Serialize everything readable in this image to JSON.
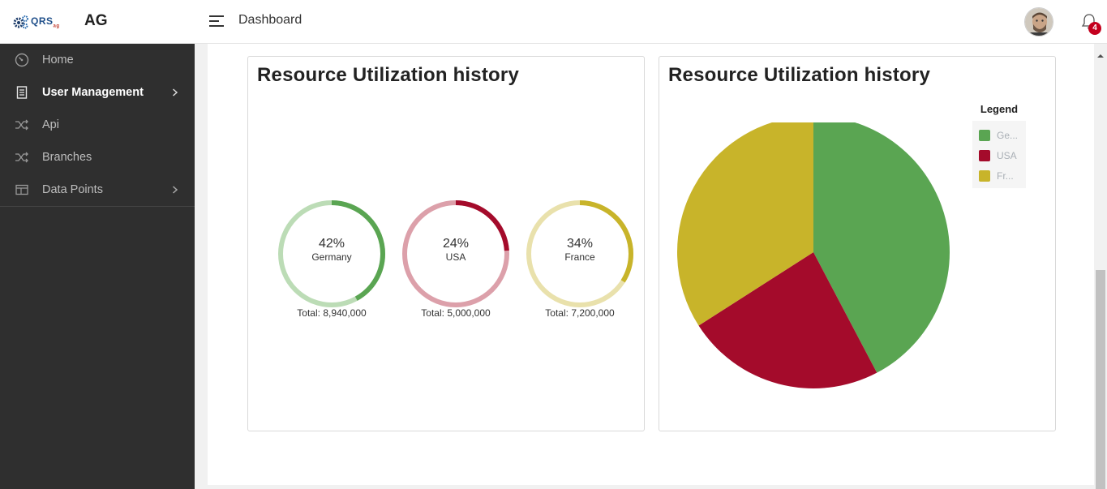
{
  "header": {
    "brand": "AG",
    "logo_text": "QRS",
    "logo_suffix": "ag",
    "page_title": "Dashboard",
    "notification_count": "4"
  },
  "sidebar": {
    "items": [
      {
        "label": "Home",
        "icon": "dashboard-gauge-icon",
        "has_submenu": false,
        "active": false
      },
      {
        "label": "User Management",
        "icon": "document-icon",
        "has_submenu": true,
        "active": true
      },
      {
        "label": "Api",
        "icon": "shuffle-icon",
        "has_submenu": false,
        "active": false
      },
      {
        "label": "Branches",
        "icon": "shuffle-icon",
        "has_submenu": false,
        "active": false
      },
      {
        "label": "Data Points",
        "icon": "table-icon",
        "has_submenu": true,
        "active": false
      }
    ]
  },
  "cards": [
    {
      "title": "Resource Utilization history",
      "gauges": [
        {
          "percent": "42%",
          "name": "Germany",
          "total": "Total: 8,940,000",
          "value": 0.42,
          "color": "#5aa552",
          "track": "#bcdcb6"
        },
        {
          "percent": "24%",
          "name": "USA",
          "total": "Total: 5,000,000",
          "value": 0.24,
          "color": "#a40b2b",
          "track": "#dca0aa"
        },
        {
          "percent": "34%",
          "name": "France",
          "total": "Total: 7,200,000",
          "value": 0.34,
          "color": "#c8b42a",
          "track": "#e9e1ac"
        }
      ]
    },
    {
      "title": "Resource Utilization history",
      "legend_title": "Legend",
      "legend": [
        {
          "label": "Ge...",
          "color": "#5aa552"
        },
        {
          "label": "USA",
          "color": "#a40b2b"
        },
        {
          "label": "Fr...",
          "color": "#c8b42a"
        }
      ]
    }
  ],
  "chart_data": [
    {
      "type": "pie",
      "title": "Resource Utilization history",
      "series": [
        {
          "name": "Germany",
          "value": 42
        },
        {
          "name": "USA",
          "value": 24
        },
        {
          "name": "France",
          "value": 34
        }
      ],
      "totals": [
        8940000,
        5000000,
        7200000
      ],
      "style": "donut-gauges"
    },
    {
      "type": "pie",
      "title": "Resource Utilization history",
      "categories": [
        "Germany",
        "USA",
        "France"
      ],
      "values": [
        8940000,
        5000000,
        7200000
      ],
      "colors": [
        "#5aa552",
        "#a40b2b",
        "#c8b42a"
      ],
      "legend": "top-right"
    }
  ]
}
